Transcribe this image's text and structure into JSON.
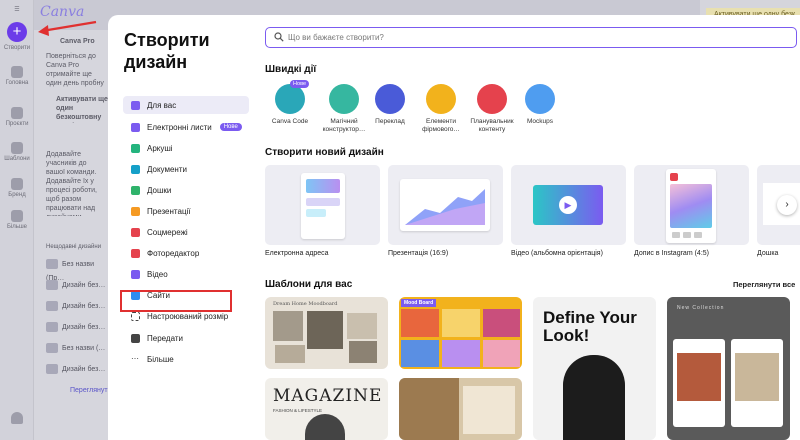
{
  "background": {
    "logo": "Canva",
    "rail": [
      {
        "label": "Створити"
      },
      {
        "label": "Головна"
      },
      {
        "label": "Проєкти"
      },
      {
        "label": "Шаблони"
      },
      {
        "label": "Бренд"
      },
      {
        "label": "Більше"
      }
    ],
    "panel_title": "Canva Pro",
    "panel_text_1": "Поверніться до Canva Pro отримайте ще один день пробну версію",
    "panel_text_2": "Активувати ще один безкоштовну версію",
    "panel_text_3": "Додавайте учасників до вашої команди. Додавайте їх у процесі роботи, щоб разом працювати над дизайнами",
    "recent_heading": "Нещодавні дизайни",
    "recent": [
      "Без назви (Пр…",
      "Дизайн без…",
      "Дизайн без…",
      "Дизайн без…",
      "Без назви (…",
      "Дизайн без…"
    ],
    "view_all": "Переглянути",
    "notice": "Активувати ще одну безк"
  },
  "modal": {
    "title": "Створити дизайн",
    "sidebar": [
      {
        "label": "Для вас",
        "icon": "sparkle-icon",
        "color": "#7b5bf0",
        "active": true
      },
      {
        "label": "Електронні листи",
        "icon": "email-icon",
        "color": "#7b5bf0",
        "badge": "Нове"
      },
      {
        "label": "Аркуші",
        "icon": "sheet-icon",
        "color": "#24b47e"
      },
      {
        "label": "Документи",
        "icon": "document-icon",
        "color": "#15a0c8"
      },
      {
        "label": "Дошки",
        "icon": "whiteboard-icon",
        "color": "#2fb36b"
      },
      {
        "label": "Презентації",
        "icon": "presentation-icon",
        "color": "#f59a23"
      },
      {
        "label": "Соцмережі",
        "icon": "heart-icon",
        "color": "#e5424d"
      },
      {
        "label": "Фоторедактор",
        "icon": "photo-icon",
        "color": "#e5424d"
      },
      {
        "label": "Відео",
        "icon": "video-icon",
        "color": "#7b5bf0"
      },
      {
        "label": "Сайти",
        "icon": "website-icon",
        "color": "#2f8cf0"
      },
      {
        "label": "Настроюваний розмір",
        "icon": "custom-size-icon",
        "color": "#444444"
      },
      {
        "label": "Передати",
        "icon": "upload-icon",
        "color": "#444444"
      },
      {
        "label": "Більше",
        "icon": "more-icon",
        "color": "#444444"
      }
    ],
    "search": {
      "placeholder": "Що ви бажаєте створити?"
    },
    "quick_heading": "Швидкі дії",
    "quick": [
      {
        "label": "Canva Code",
        "tag": "Нове",
        "color": "#2aa7b8"
      },
      {
        "label": "Магічний конструктор…",
        "color": "#36b7a0"
      },
      {
        "label": "Переклад",
        "color": "#4a5bd8"
      },
      {
        "label": "Елементи фірмового…",
        "color": "#f2b21c"
      },
      {
        "label": "Планувальник контенту",
        "color": "#e5424d"
      },
      {
        "label": "Mockups",
        "color": "#4f9df0"
      }
    ],
    "new_heading": "Створити новий дизайн",
    "new_designs": [
      {
        "label": "Електронна адреса"
      },
      {
        "label": "Презентація (16:9)"
      },
      {
        "label": "Відео (альбомна орієнтація)"
      },
      {
        "label": "Допис в Instagram (4:5)"
      },
      {
        "label": "Дошка"
      }
    ],
    "templates_heading": "Шаблони для вас",
    "see_all": "Переглянути все",
    "templates": [
      {
        "title": "Dream Home Moodboard"
      },
      {
        "title": "Mood Board"
      },
      {
        "title": "Define Your Look!"
      },
      {
        "title": "New Collection"
      },
      {
        "title": "MAGAZINE",
        "subtitle": "FASHION & LIFESTYLE"
      },
      {
        "title": ""
      }
    ]
  },
  "colors": {
    "accent": "#7b5bf0",
    "highlight": "#e03030"
  }
}
